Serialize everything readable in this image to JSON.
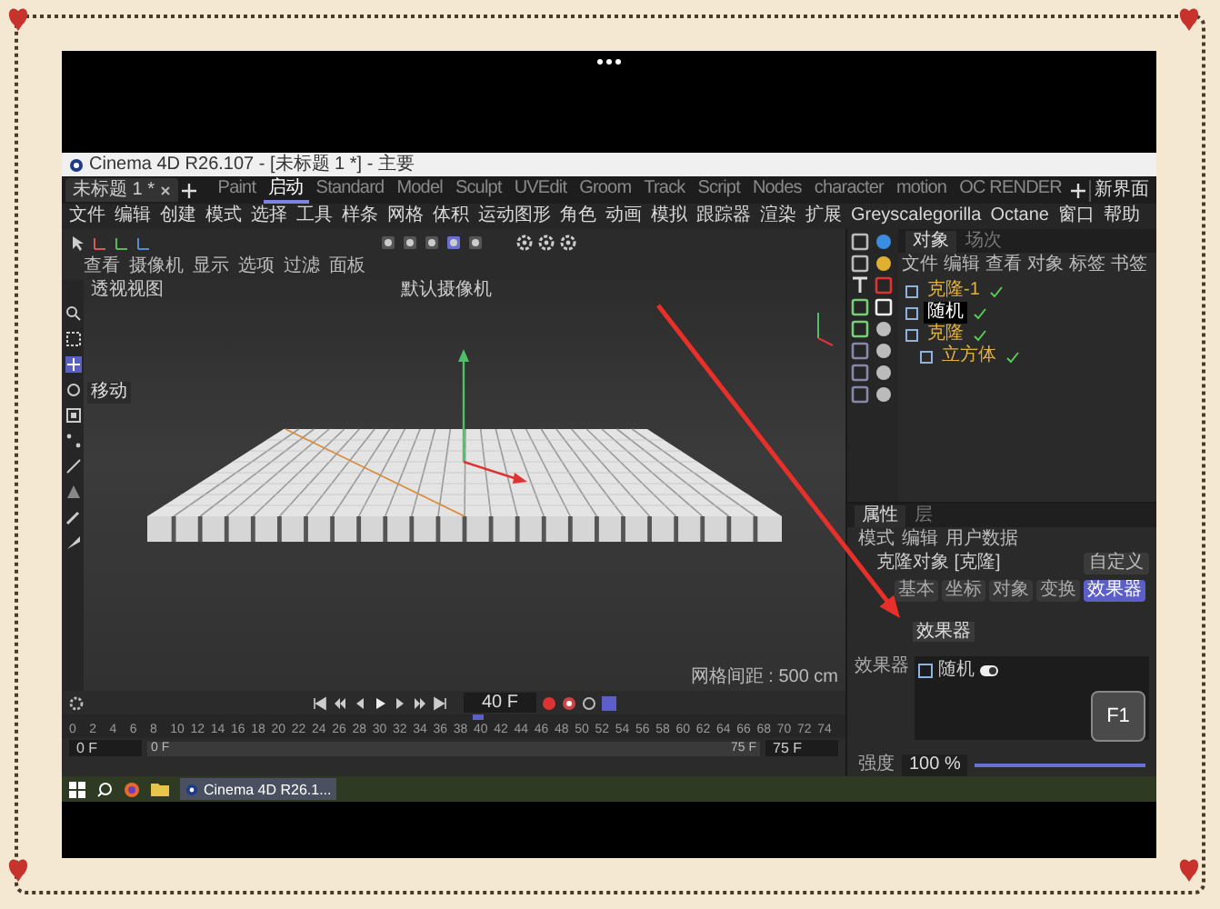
{
  "window": {
    "title": "Cinema 4D R26.107 - [未标题 1 *] - 主要"
  },
  "document_tab": {
    "label": "未标题 1 *"
  },
  "layouts": [
    {
      "label": "Paint",
      "selected": false
    },
    {
      "label": "启动",
      "selected": true
    },
    {
      "label": "Standard",
      "selected": false
    },
    {
      "label": "Model",
      "selected": false
    },
    {
      "label": "Sculpt",
      "selected": false
    },
    {
      "label": "UVEdit",
      "selected": false
    },
    {
      "label": "Groom",
      "selected": false
    },
    {
      "label": "Track",
      "selected": false
    },
    {
      "label": "Script",
      "selected": false
    },
    {
      "label": "Nodes",
      "selected": false
    },
    {
      "label": "character",
      "selected": false
    },
    {
      "label": "motion",
      "selected": false
    },
    {
      "label": "OC RENDER",
      "selected": false
    }
  ],
  "new_layout": "新界面",
  "menu": [
    "文件",
    "编辑",
    "创建",
    "模式",
    "选择",
    "工具",
    "样条",
    "网格",
    "体积",
    "运动图形",
    "角色",
    "动画",
    "模拟",
    "跟踪器",
    "渲染",
    "扩展",
    "Greyscalegorilla",
    "Octane",
    "窗口",
    "帮助"
  ],
  "viewport_menu": [
    "查看",
    "摄像机",
    "显示",
    "选项",
    "过滤",
    "面板"
  ],
  "viewport": {
    "name": "透视视图",
    "camera": "默认摄像机",
    "tooltip": "移动",
    "grid_spacing": "网格间距 : 500 cm"
  },
  "object_manager": {
    "tabs": [
      {
        "label": "对象",
        "selected": true
      },
      {
        "label": "场次",
        "selected": false
      }
    ],
    "menu": [
      "文件",
      "编辑",
      "查看",
      "对象",
      "标签",
      "书签"
    ],
    "objects": [
      {
        "name": "克隆-1",
        "selected": false
      },
      {
        "name": "随机",
        "selected": true
      },
      {
        "name": "克隆",
        "selected": false,
        "children": [
          {
            "name": "立方体",
            "selected": false
          }
        ]
      }
    ]
  },
  "attributes": {
    "tabs": [
      {
        "label": "属性",
        "selected": true
      },
      {
        "label": "层",
        "selected": false
      }
    ],
    "menu": [
      "模式",
      "编辑",
      "用户数据"
    ],
    "object_label": "克隆对象 [克隆]",
    "view_mode": "自定义",
    "sections": [
      {
        "label": "基本",
        "selected": false
      },
      {
        "label": "坐标",
        "selected": false
      },
      {
        "label": "对象",
        "selected": false
      },
      {
        "label": "变换",
        "selected": false
      },
      {
        "label": "效果器",
        "selected": true
      }
    ],
    "section_title": "效果器",
    "effectors_label": "效果器",
    "effectors": [
      {
        "name": "随机",
        "enabled": true
      }
    ],
    "strength": {
      "label": "强度",
      "reading": "100 %",
      "level": 1
    }
  },
  "timeline": {
    "current": "40 F",
    "level": 0.533,
    "ticks": [
      "0",
      "2",
      "4",
      "6",
      "8",
      "10",
      "12",
      "14",
      "16",
      "18",
      "20",
      "22",
      "24",
      "26",
      "28",
      "30",
      "32",
      "34",
      "36",
      "38",
      "40",
      "42",
      "44",
      "46",
      "48",
      "50",
      "52",
      "54",
      "56",
      "58",
      "60",
      "62",
      "64",
      "66",
      "68",
      "70",
      "72",
      "74"
    ],
    "range": {
      "min": "0 F",
      "start": "0 F",
      "end": "75 F",
      "max": "75 F"
    }
  },
  "taskbar": {
    "app": "Cinema 4D R26.1..."
  },
  "key_overlay": "F1"
}
